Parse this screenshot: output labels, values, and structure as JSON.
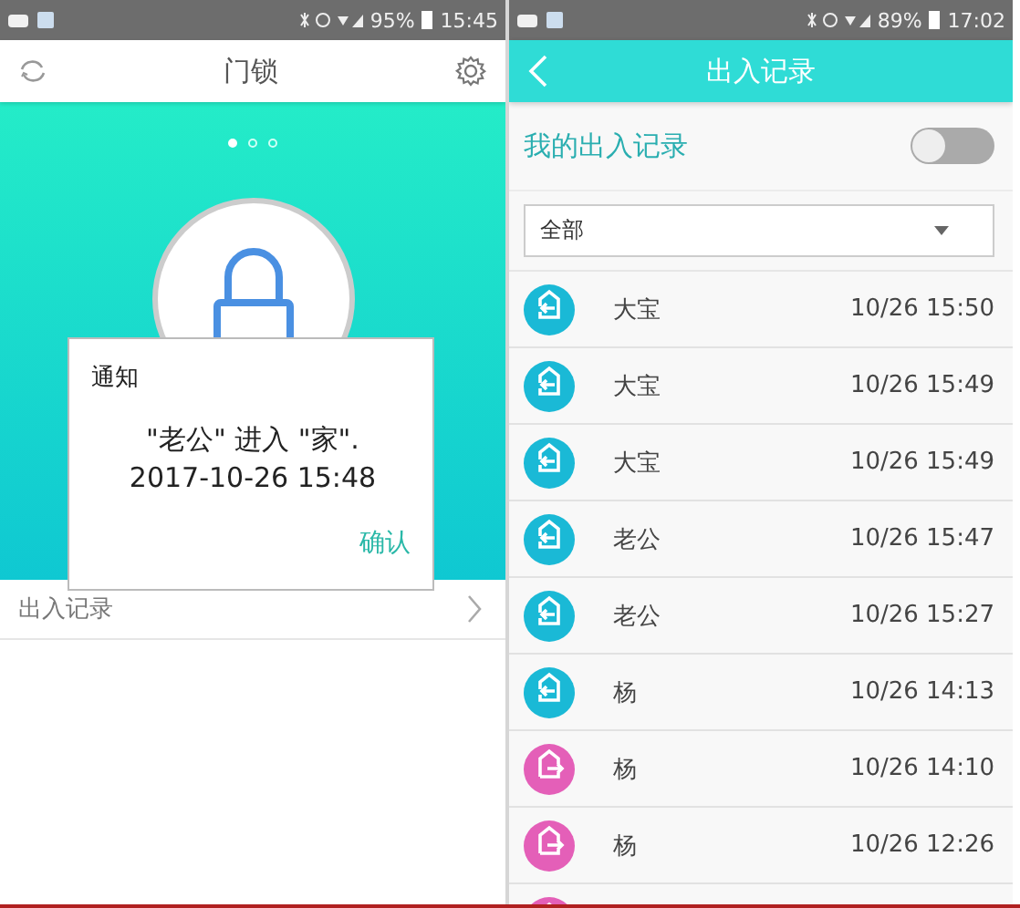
{
  "left_screen": {
    "status_bar": {
      "battery": "95%",
      "time": "15:45"
    },
    "title": "门锁",
    "pager": [
      {
        "selected": true
      },
      {
        "selected": false
      },
      {
        "selected": false
      }
    ],
    "menu_item": "出入记录",
    "dialog": {
      "title": "通知",
      "message": "\"老公\" 进入 \"家\".",
      "time": "2017-10-26 15:48",
      "button": "确认"
    }
  },
  "right_screen": {
    "status_bar": {
      "battery": "89%",
      "time": "17:02"
    },
    "title": "出入记录",
    "my_records": {
      "label": "我的出入记录",
      "on": false
    },
    "filter": {
      "value": "全部"
    },
    "records": [
      {
        "kind": "in",
        "name": "大宝",
        "time": "10/26 15:50"
      },
      {
        "kind": "in",
        "name": "大宝",
        "time": "10/26 15:49"
      },
      {
        "kind": "in",
        "name": "大宝",
        "time": "10/26 15:49"
      },
      {
        "kind": "in",
        "name": "老公",
        "time": "10/26 15:47"
      },
      {
        "kind": "in",
        "name": "老公",
        "time": "10/26 15:27"
      },
      {
        "kind": "in",
        "name": "杨",
        "time": "10/26 14:13"
      },
      {
        "kind": "out",
        "name": "杨",
        "time": "10/26 14:10"
      },
      {
        "kind": "out",
        "name": "杨",
        "time": "10/26 12:26"
      },
      {
        "kind": "out"
      }
    ]
  }
}
